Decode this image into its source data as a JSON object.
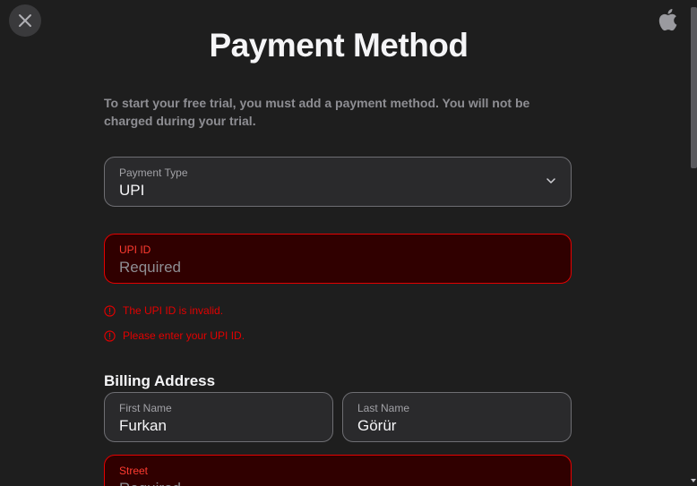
{
  "header": {
    "title": "Payment Method"
  },
  "intro_text": "To start your free trial, you must add a payment method. You will not be charged during your trial.",
  "payment_type": {
    "label": "Payment Type",
    "value": "UPI"
  },
  "upi_id": {
    "label": "UPI ID",
    "placeholder": "Required",
    "value": ""
  },
  "errors": [
    "The UPI ID is invalid.",
    "Please enter your UPI ID."
  ],
  "billing": {
    "title": "Billing Address",
    "first_name": {
      "label": "First Name",
      "value": "Furkan"
    },
    "last_name": {
      "label": "Last Name",
      "value": "Görür"
    },
    "street": {
      "label": "Street",
      "placeholder": "Required",
      "value": ""
    }
  },
  "colors": {
    "background": "#1e1e1e",
    "error": "#e30000",
    "error_bg": "#300000"
  }
}
